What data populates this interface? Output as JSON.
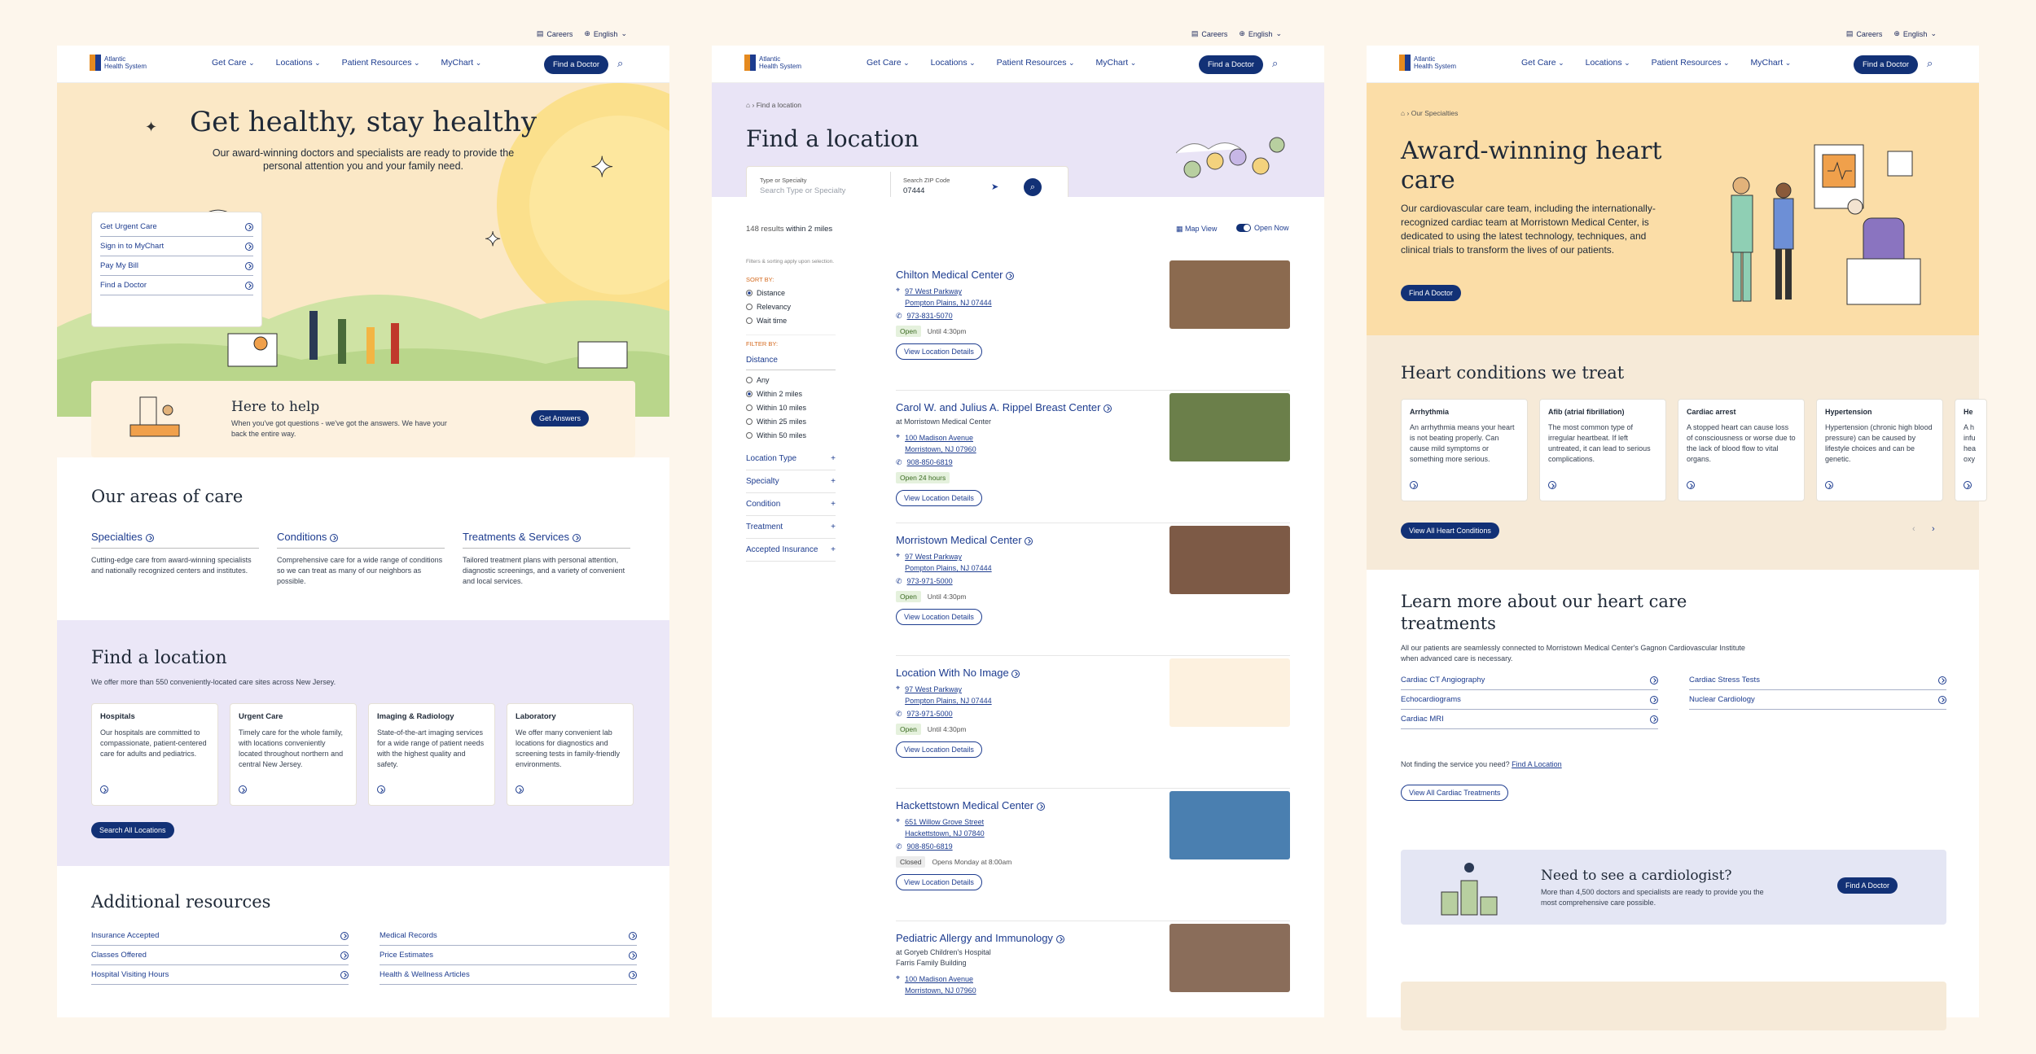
{
  "common": {
    "careers": "Careers",
    "language": "English",
    "logo_line1": "Atlantic",
    "logo_line2": "Health System",
    "menu": [
      "Get Care",
      "Locations",
      "Patient Resources",
      "MyChart"
    ],
    "find_doctor": "Find a Doctor"
  },
  "home": {
    "hero_title": "Get healthy, stay healthy",
    "hero_sub": "Our award-winning doctors and specialists are ready to provide the personal attention you and your family need.",
    "quick_links": [
      "Get Urgent Care",
      "Sign in to MyChart",
      "Pay My Bill",
      "Find a Doctor"
    ],
    "help_title": "Here to help",
    "help_text": "When you've got questions - we've got the answers. We have your back the entire way.",
    "help_btn": "Get Answers",
    "areas_title": "Our areas of care",
    "areas": [
      {
        "title": "Specialties",
        "text": "Cutting-edge care from award-winning specialists and nationally recognized centers and institutes."
      },
      {
        "title": "Conditions",
        "text": "Comprehensive care for a wide range of conditions so we can treat as many of our neighbors as possible."
      },
      {
        "title": "Treatments & Services",
        "text": "Tailored treatment plans with personal attention, diagnostic screenings, and a variety of convenient and local services."
      }
    ],
    "loc_title": "Find a location",
    "loc_sub": "We offer more than 550 conveniently-located care sites across New Jersey.",
    "loc_cards": [
      {
        "title": "Hospitals",
        "text": "Our hospitals are committed to compassionate, patient-centered care for adults and pediatrics."
      },
      {
        "title": "Urgent Care",
        "text": "Timely care for the whole family, with locations conveniently located throughout northern and central New Jersey."
      },
      {
        "title": "Imaging & Radiology",
        "text": "State-of-the-art imaging services for a wide range of patient needs with the highest quality and safety."
      },
      {
        "title": "Laboratory",
        "text": "We offer many convenient lab locations for diagnostics and screening tests in family-friendly environments."
      }
    ],
    "loc_btn": "Search All Locations",
    "res_title": "Additional resources",
    "res_left": [
      "Insurance Accepted",
      "Classes Offered",
      "Hospital Visiting Hours"
    ],
    "res_right": [
      "Medical Records",
      "Price Estimates",
      "Health & Wellness Articles"
    ]
  },
  "locations": {
    "crumb": "Find a location",
    "title": "Find a location",
    "type_label": "Type or Specialty",
    "type_ph": "Search Type or Specialty",
    "zip_label": "Search ZIP Code",
    "zip_val": "07444",
    "results": "148 results",
    "within": "within 2 miles",
    "map_view": "Map View",
    "open_now": "Open Now",
    "filter_note": "Filters & sorting apply upon selection.",
    "sort_by": "SORT BY:",
    "sort_opts": [
      "Distance",
      "Relevancy",
      "Wait time"
    ],
    "filter_by": "FILTER BY:",
    "distance": "Distance",
    "dist_opts": [
      "Any",
      "Within 2 miles",
      "Within 10 miles",
      "Within 25 miles",
      "Within 50 miles"
    ],
    "facets": [
      "Location Type",
      "Specialty",
      "Condition",
      "Treatment",
      "Accepted Insurance"
    ],
    "details_btn": "View Location Details",
    "items": [
      {
        "name": "Chilton Medical Center",
        "sub": "",
        "addr1": "97 West Parkway",
        "addr2": "Pompton Plains, NJ 07444",
        "phone": "973-831-5070",
        "status": "Open",
        "hours": "Until 4:30pm"
      },
      {
        "name": "Carol W. and Julius A. Rippel Breast Center",
        "sub": "at Morristown Medical Center",
        "addr1": "100 Madison Avenue",
        "addr2": "Morristown, NJ 07960",
        "phone": "908-850-6819",
        "status": "Open 24 hours",
        "hours": ""
      },
      {
        "name": "Morristown Medical Center",
        "sub": "",
        "addr1": "97 West Parkway",
        "addr2": "Pompton Plains, NJ 07444",
        "phone": "973-971-5000",
        "status": "Open",
        "hours": "Until 4:30pm"
      },
      {
        "name": "Location With No Image",
        "sub": "",
        "addr1": "97 West Parkway",
        "addr2": "Pompton Plains, NJ 07444",
        "phone": "973-971-5000",
        "status": "Open",
        "hours": "Until 4:30pm"
      },
      {
        "name": "Hackettstown Medical Center",
        "sub": "",
        "addr1": "651 Willow Grove Street",
        "addr2": "Hackettstown, NJ 07840",
        "phone": "908-850-6819",
        "status": "Closed",
        "hours": "Opens Monday at 8:00am"
      },
      {
        "name": "Pediatric Allergy and Immunology",
        "sub": "at Goryeb Children's Hospital",
        "sub2": "Farris Family Building",
        "addr1": "100 Madison Avenue",
        "addr2": "Morristown, NJ 07960",
        "phone": "",
        "status": "",
        "hours": ""
      }
    ]
  },
  "heart": {
    "crumb": "Our Specialties",
    "title": "Award-winning heart care",
    "intro": "Our cardiovascular care team, including the internationally-recognized cardiac team at Morristown Medical Center, is dedicated to using the latest technology, techniques, and clinical trials to transform the lives of our patients.",
    "btn": "Find A Doctor",
    "cond_title": "Heart conditions we treat",
    "conditions": [
      {
        "title": "Arrhythmia",
        "text": "An arrhythmia means your heart is not beating properly. Can cause mild symptoms or something more serious."
      },
      {
        "title": "Afib (atrial fibrillation)",
        "text": "The most common type of irregular heartbeat. If left untreated, it can lead to serious complications."
      },
      {
        "title": "Cardiac arrest",
        "text": "A stopped heart can cause loss of consciousness or worse due to the lack of blood flow to vital organs."
      },
      {
        "title": "Hypertension",
        "text": "Hypertension (chronic high blood pressure) can be caused by lifestyle choices and can be genetic."
      },
      {
        "title": "He",
        "text": "A h infu hea oxy"
      }
    ],
    "cond_btn": "View All Heart Conditions",
    "learn_title": "Learn more about our heart care treatments",
    "learn_sub": "All our patients are seamlessly connected to Morristown Medical Center's Gagnon Cardiovascular Institute when advanced care is necessary.",
    "treat_left": [
      "Cardiac CT Angiography",
      "Echocardiograms",
      "Cardiac MRI"
    ],
    "treat_right": [
      "Cardiac Stress Tests",
      "Nuclear Cardiology"
    ],
    "not_finding": "Not finding the service you need?",
    "find_loc": "Find A Location",
    "treat_btn": "View All Cardiac Treatments",
    "need_title": "Need to see a cardiologist?",
    "need_text": "More than 4,500 doctors and specialists are ready to provide you the most comprehensive care possible.",
    "need_btn": "Find A Doctor"
  }
}
